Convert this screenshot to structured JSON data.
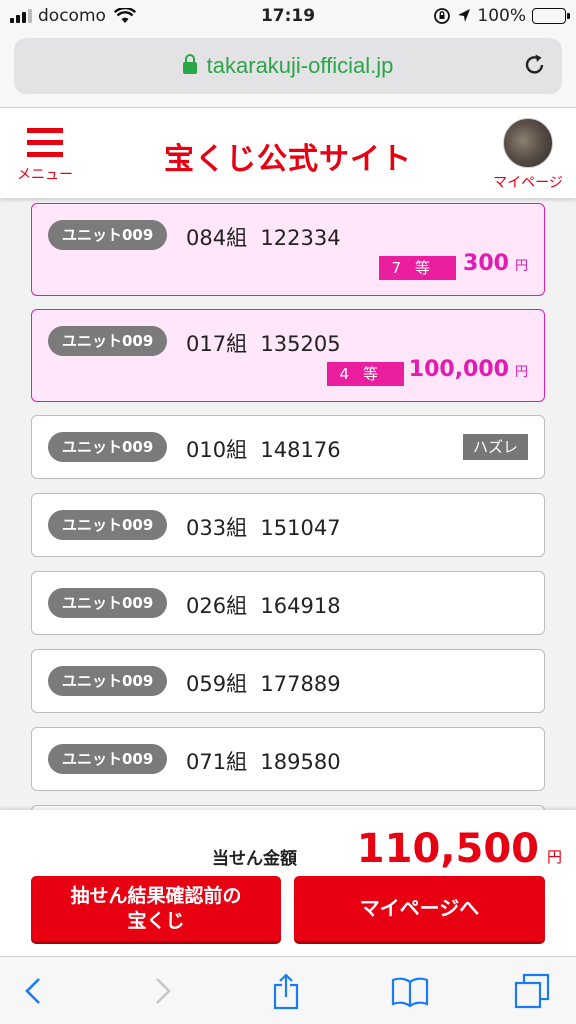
{
  "status_bar": {
    "carrier": "docomo",
    "time": "17:19",
    "battery": "100%"
  },
  "browser": {
    "url": "takarakuji-official.jp"
  },
  "header": {
    "menu_label": "メニュー",
    "site_title": "宝くじ公式サイト",
    "mypage_label": "マイページ"
  },
  "tickets": [
    {
      "unit": "ユニット009",
      "number": "084組  122334",
      "grade": "7等",
      "prize": "300",
      "yen": "円"
    },
    {
      "unit": "ユニット009",
      "number": "017組  135205",
      "grade": "4等",
      "prize": "100,000",
      "yen": "円"
    },
    {
      "unit": "ユニット009",
      "number": "010組  148176",
      "result": "ハズレ"
    },
    {
      "unit": "ユニット009",
      "number": "033組  151047"
    },
    {
      "unit": "ユニット009",
      "number": "026組  164918"
    },
    {
      "unit": "ユニット009",
      "number": "059組  177889"
    },
    {
      "unit": "ユニット009",
      "number": "071組  189580"
    }
  ],
  "summary": {
    "label": "当せん金額",
    "amount": "110,500",
    "yen": "円"
  },
  "buttons": {
    "unchecked_line1": "抽せん結果確認前の",
    "unchecked_line2": "宝くじ",
    "mypage": "マイページへ"
  },
  "colors": {
    "brand_red": "#e60012",
    "win_pink": "#e21bb1",
    "win_bg": "#ffe6fa"
  }
}
